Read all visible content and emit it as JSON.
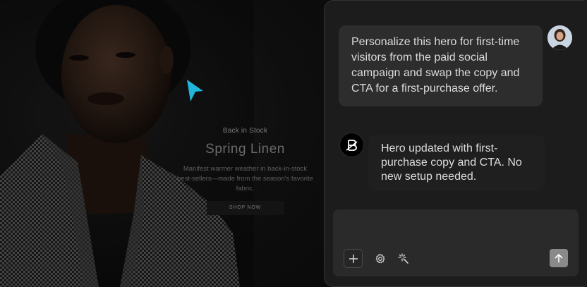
{
  "hero": {
    "eyebrow": "Back in Stock",
    "title": "Spring Linen",
    "description": "Manifest warmer weather in back-in-stock best-sellers—made from the season's favorite fabric.",
    "cta_label": "SHOP NOW"
  },
  "chat": {
    "user_message": "Personalize this hero for first-time visitors from the paid social campaign and swap the copy and CTA for a first-purchase offer.",
    "assistant_message": "Hero updated with first-purchase copy and CTA. No new setup needed.",
    "composer": {
      "value": "",
      "placeholder": ""
    }
  },
  "icons": {
    "cursor": "pointer-cursor-icon",
    "assistant": "brand-logo-icon",
    "add": "plus-icon",
    "settings": "gear-icon",
    "magic": "sparkle-icon",
    "send": "arrow-up-icon"
  },
  "colors": {
    "cursor": "#1fb6d9",
    "panel_bg": "#1c1c1c",
    "bubble_bg": "#2d2d2d",
    "send_button": "#8a8a8a"
  }
}
